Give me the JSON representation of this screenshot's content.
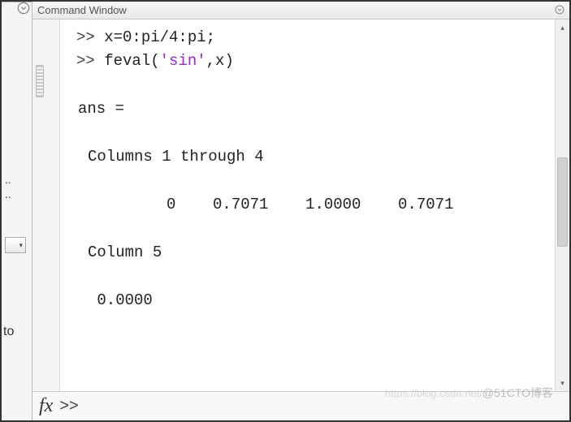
{
  "window": {
    "title": "Command Window"
  },
  "leftPanel": {
    "toLabel": "to",
    "dots1": "..",
    "dots2": ".."
  },
  "code": {
    "prompt1": ">> ",
    "line1": "x=0:pi/4:pi;",
    "prompt2": ">> ",
    "line2_pre": "feval(",
    "line2_str": "'sin'",
    "line2_post": ",x)",
    "ans_label": "ans =",
    "cols_header": "Columns 1 through 4",
    "cols_values": "     0    0.7071    1.0000    0.7071",
    "col5_header": "Column 5",
    "col5_value": " 0.0000"
  },
  "chart_data": {
    "type": "table",
    "title": "feval('sin', x) output",
    "x_description": "0:pi/4:pi",
    "values": [
      0,
      0.7071,
      1.0,
      0.7071,
      0.0
    ]
  },
  "footer": {
    "fx": "fx",
    "prompt": ">>"
  },
  "watermark": {
    "url": "https://blog.csdn.net/",
    "handle": "@51CTO博客"
  }
}
